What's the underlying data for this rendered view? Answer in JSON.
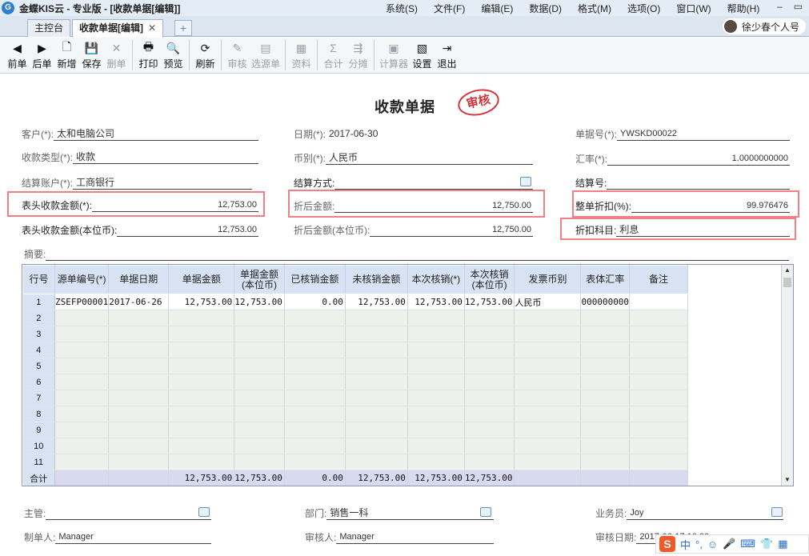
{
  "app": {
    "title": "金蝶KIS云 - 专业版 - [收款单据[编辑]]",
    "logo_glyph": "G",
    "menu": [
      "系统(S)",
      "文件(F)",
      "编辑(E)",
      "数据(D)",
      "格式(M)",
      "选项(O)",
      "窗口(W)",
      "帮助(H)"
    ],
    "window_controls": [
      "–",
      "▭"
    ]
  },
  "tabs": {
    "items": [
      {
        "label": "主控台"
      },
      {
        "label": "收款单据[编辑]",
        "close": "✕"
      }
    ],
    "add": "+"
  },
  "user": {
    "name": "徐少春个人号"
  },
  "toolbar": {
    "buttons": [
      {
        "label": "前单",
        "icon": "◀",
        "enabled": true
      },
      {
        "label": "后单",
        "icon": "▶",
        "enabled": true
      },
      {
        "label": "新增",
        "icon": "🗋",
        "enabled": true
      },
      {
        "label": "保存",
        "icon": "💾",
        "enabled": true
      },
      {
        "label": "删单",
        "icon": "✕",
        "enabled": false
      },
      {
        "label": "打印",
        "icon": "🖶",
        "enabled": true
      },
      {
        "label": "预览",
        "icon": "🔍",
        "enabled": true
      },
      {
        "label": "刷新",
        "icon": "⟳",
        "enabled": true
      },
      {
        "label": "审核",
        "icon": "✎",
        "enabled": false
      },
      {
        "label": "选源单",
        "icon": "▤",
        "enabled": false
      },
      {
        "label": "资料",
        "icon": "▦",
        "enabled": false
      },
      {
        "label": "合计",
        "icon": "Σ",
        "enabled": false
      },
      {
        "label": "分摊",
        "icon": "⇶",
        "enabled": false
      },
      {
        "label": "计算器",
        "icon": "▣",
        "enabled": false
      },
      {
        "label": "设置",
        "icon": "▧",
        "enabled": true
      },
      {
        "label": "退出",
        "icon": "⇥",
        "enabled": true
      }
    ]
  },
  "document": {
    "title": "收款单据",
    "stamp": "审核"
  },
  "fields": {
    "customer": {
      "label": "客户(*):",
      "value": "太和电脑公司"
    },
    "date": {
      "label": "日期(*):",
      "value": "2017-06-30"
    },
    "doc_no": {
      "label": "单据号(*):",
      "value": "YWSKD00022"
    },
    "receipt_type": {
      "label": "收款类型(*):",
      "value": "收款"
    },
    "currency": {
      "label": "币别(*):",
      "value": "人民币"
    },
    "exchange_rate": {
      "label": "汇率(*):",
      "value": "1.0000000000"
    },
    "settle_account": {
      "label": "结算账户(*):",
      "value": "工商银行"
    },
    "settle_method": {
      "label": "结算方式:",
      "value": ""
    },
    "settle_no": {
      "label": "结算号:",
      "value": ""
    },
    "header_amount": {
      "label": "表头收款金额(*):",
      "value": "12,753.00"
    },
    "discounted_amount": {
      "label": "折后金额:",
      "value": "12,750.00"
    },
    "discount_rate": {
      "label": "整单折扣(%):",
      "value": "99.976476"
    },
    "header_amount_local": {
      "label": "表头收款金额(本位币):",
      "value": "12,753.00"
    },
    "discounted_amount_local": {
      "label": "折后金额(本位币):",
      "value": "12,750.00"
    },
    "discount_subject": {
      "label": "折扣科目:",
      "value": "利息"
    },
    "memo": {
      "label": "摘要:",
      "value": ""
    },
    "manager": {
      "label": "主管:",
      "value": ""
    },
    "department": {
      "label": "部门:",
      "value": "销售一科"
    },
    "salesman": {
      "label": "业务员:",
      "value": "Joy"
    },
    "maker": {
      "label": "制单人:",
      "value": "Manager"
    },
    "auditor": {
      "label": "审核人:",
      "value": "Manager"
    },
    "audit_date": {
      "label": "审核日期:",
      "value": "2017-06-17 10:00"
    }
  },
  "grid": {
    "columns": [
      "行号",
      "源单编号(*)",
      "单据日期",
      "单据金额",
      "单据金额(本位币)",
      "已核销金额",
      "未核销金额",
      "本次核销(*)",
      "本次核销(本位币)",
      "发票币别",
      "表体汇率",
      "备注"
    ],
    "rows": [
      {
        "no": "1",
        "cells": [
          "ZSEFP00001",
          "2017-06-26",
          "12,753.00",
          "12,753.00",
          "0.00",
          "12,753.00",
          "12,753.00",
          "12,753.00",
          "人民币",
          "000000000",
          ""
        ]
      },
      {
        "no": "2",
        "cells": [
          "",
          "",
          "",
          "",
          "",
          "",
          "",
          "",
          "",
          "",
          ""
        ]
      },
      {
        "no": "3",
        "cells": [
          "",
          "",
          "",
          "",
          "",
          "",
          "",
          "",
          "",
          "",
          ""
        ]
      },
      {
        "no": "4",
        "cells": [
          "",
          "",
          "",
          "",
          "",
          "",
          "",
          "",
          "",
          "",
          ""
        ]
      },
      {
        "no": "5",
        "cells": [
          "",
          "",
          "",
          "",
          "",
          "",
          "",
          "",
          "",
          "",
          ""
        ]
      },
      {
        "no": "6",
        "cells": [
          "",
          "",
          "",
          "",
          "",
          "",
          "",
          "",
          "",
          "",
          ""
        ]
      },
      {
        "no": "7",
        "cells": [
          "",
          "",
          "",
          "",
          "",
          "",
          "",
          "",
          "",
          "",
          ""
        ]
      },
      {
        "no": "8",
        "cells": [
          "",
          "",
          "",
          "",
          "",
          "",
          "",
          "",
          "",
          "",
          ""
        ]
      },
      {
        "no": "9",
        "cells": [
          "",
          "",
          "",
          "",
          "",
          "",
          "",
          "",
          "",
          "",
          ""
        ]
      },
      {
        "no": "10",
        "cells": [
          "",
          "",
          "",
          "",
          "",
          "",
          "",
          "",
          "",
          "",
          ""
        ]
      },
      {
        "no": "11",
        "cells": [
          "",
          "",
          "",
          "",
          "",
          "",
          "",
          "",
          "",
          "",
          ""
        ]
      }
    ],
    "total": {
      "label": "合计",
      "cells": [
        "",
        "",
        "12,753.00",
        "12,753.00",
        "0.00",
        "12,753.00",
        "12,753.00",
        "12,753.00",
        "",
        "",
        ""
      ]
    }
  },
  "ime": {
    "logo": "S",
    "items": [
      "中",
      "°,",
      "☺",
      "🎤",
      "⌨",
      "👕",
      "▦"
    ]
  },
  "colors": {
    "highlight_box": "#f08085",
    "stamp": "#d6343a",
    "grid_header": "#d7e3f2"
  }
}
